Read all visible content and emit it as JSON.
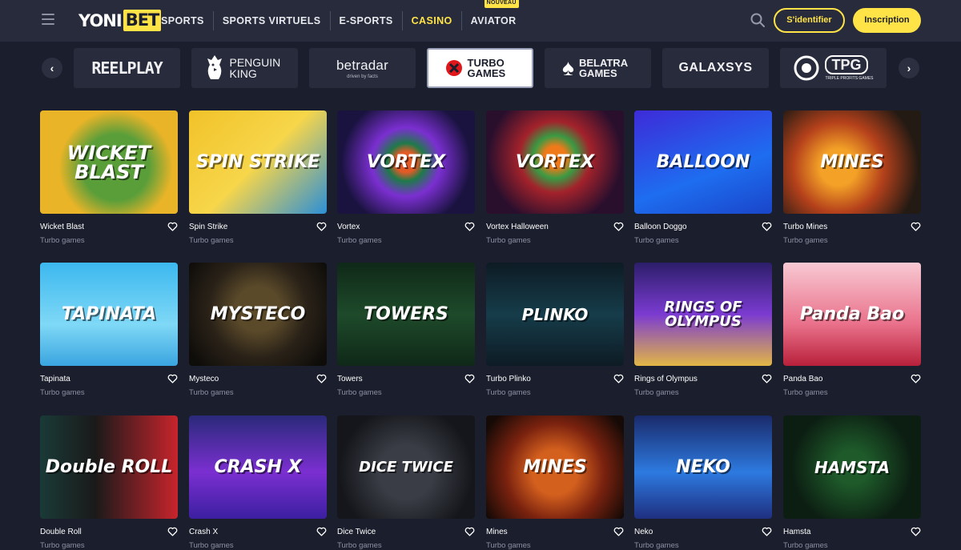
{
  "header": {
    "logo_left": "YONI",
    "logo_right": "BET",
    "nav": [
      {
        "label": "SPORTS",
        "active": false
      },
      {
        "label": "SPORTS VIRTUELS",
        "active": false
      },
      {
        "label": "E-SPORTS",
        "active": false
      },
      {
        "label": "CASINO",
        "active": true
      },
      {
        "label": "AVIATOR",
        "active": false,
        "badge": "NOUVEAU"
      }
    ],
    "login_label": "S'identifier",
    "register_label": "Inscription",
    "accent_color": "#ffe347"
  },
  "providers": [
    {
      "label": "REELPLAY",
      "selected": false
    },
    {
      "label": "PENGUIN KING",
      "selected": false
    },
    {
      "label": "betradar",
      "selected": false
    },
    {
      "label": "TURBO GAMES",
      "selected": true
    },
    {
      "label": "BELATRA GAMES",
      "selected": false
    },
    {
      "label": "GALAXSYS",
      "selected": false
    },
    {
      "label": "TPG",
      "selected": false
    }
  ],
  "games": [
    {
      "name": "Wicket Blast",
      "provider": "Turbo games",
      "art": "WICKET BLAST"
    },
    {
      "name": "Spin Strike",
      "provider": "Turbo games",
      "art": "SPIN STRIKE"
    },
    {
      "name": "Vortex",
      "provider": "Turbo games",
      "art": "VORTEX"
    },
    {
      "name": "Vortex Halloween",
      "provider": "Turbo games",
      "art": "VORTEX"
    },
    {
      "name": "Balloon Doggo",
      "provider": "Turbo games",
      "art": "BALLOON"
    },
    {
      "name": "Turbo Mines",
      "provider": "Turbo games",
      "art": "MINES"
    },
    {
      "name": "Tapinata",
      "provider": "Turbo games",
      "art": "TAPINATA"
    },
    {
      "name": "Mysteco",
      "provider": "Turbo games",
      "art": "MYSTECO"
    },
    {
      "name": "Towers",
      "provider": "Turbo games",
      "art": "TOWERS"
    },
    {
      "name": "Turbo Plinko",
      "provider": "Turbo games",
      "art": "PLINKO"
    },
    {
      "name": "Rings of Olympus",
      "provider": "Turbo games",
      "art": "RINGS OF OLYMPUS"
    },
    {
      "name": "Panda Bao",
      "provider": "Turbo games",
      "art": "Panda Bao"
    },
    {
      "name": "Double Roll",
      "provider": "Turbo games",
      "art": "Double ROLL"
    },
    {
      "name": "Crash X",
      "provider": "Turbo games",
      "art": "CRASH X"
    },
    {
      "name": "Dice Twice",
      "provider": "Turbo games",
      "art": "DICE TWICE"
    },
    {
      "name": "Mines",
      "provider": "Turbo games",
      "art": "MINES"
    },
    {
      "name": "Neko",
      "provider": "Turbo games",
      "art": "NEKO"
    },
    {
      "name": "Hamsta",
      "provider": "Turbo games",
      "art": "HAMSTA"
    }
  ]
}
